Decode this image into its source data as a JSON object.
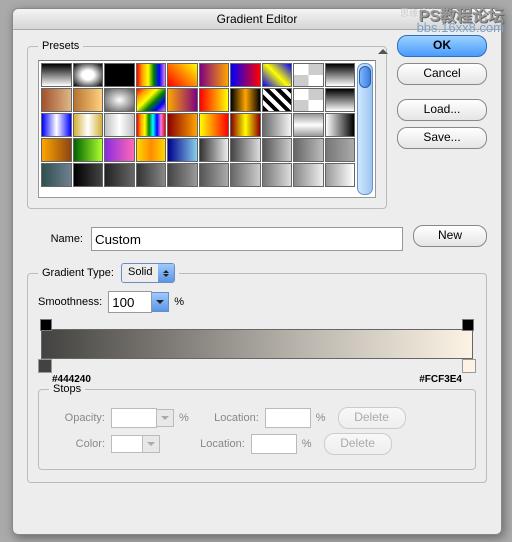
{
  "watermark": {
    "a": "PS教程论坛",
    "b": "思缘设计论坛",
    "c": "bbs.16xx8.com"
  },
  "title": "Gradient Editor",
  "presets": {
    "legend": "Presets",
    "swatches": [
      "linear-gradient(#000,#fff)",
      "radial-gradient(#fff 30%,#000)",
      "linear-gradient(#000,#000)",
      "linear-gradient(90deg,red,orange,yellow,green,blue,violet)",
      "linear-gradient(45deg,red,yellow)",
      "linear-gradient(90deg,purple,orange)",
      "linear-gradient(90deg,blue,red)",
      "linear-gradient(45deg,blue,yellow,blue)",
      "repeating-conic-gradient(#ccc 0 25%,#fff 0 50%)",
      "linear-gradient(#000,#fff)",
      "linear-gradient(90deg,#a0522d,#deb887)",
      "linear-gradient(90deg,#b87333,#ffd27f)",
      "radial-gradient(#fff,#555)",
      "linear-gradient(135deg,red,orange,yellow,green,blue,violet)",
      "linear-gradient(90deg,orange,purple)",
      "linear-gradient(90deg,red,yellow)",
      "linear-gradient(90deg,#000,orange,#000)",
      "repeating-linear-gradient(45deg,#000 0 4px,#fff 4px 8px)",
      "repeating-conic-gradient(#ccc 0 25%,#fff 0 50%)",
      "linear-gradient(#000,#fff)",
      "linear-gradient(90deg,#00f,#fff,#00f)",
      "linear-gradient(90deg,#d4af37,#fff,#d4af37)",
      "linear-gradient(90deg,#c0c0c0,#fff,#c0c0c0)",
      "linear-gradient(90deg,red,orange,yellow,green,cyan,blue,violet,red)",
      "linear-gradient(90deg,#8b0000,#ffa500)",
      "linear-gradient(90deg,#ff0,#f00)",
      "linear-gradient(90deg,#8b0000,#ffff00,#8b0000)",
      "linear-gradient(90deg,#696969,#f5f5f5)",
      "linear-gradient(#999,#fff,#999)",
      "linear-gradient(90deg,#fff,#000)",
      "linear-gradient(90deg,orange,#8b4513)",
      "linear-gradient(90deg,#006400,#adff2f)",
      "linear-gradient(90deg,#8a2be2,#ff69b4)",
      "linear-gradient(90deg,#ffd700,#ff8c00,#ffd700)",
      "linear-gradient(90deg,#00008b,#87ceeb)",
      "linear-gradient(90deg,#333,#eee)",
      "linear-gradient(90deg,#444,#ddd)",
      "linear-gradient(90deg,#555,#ccc)",
      "linear-gradient(90deg,#666,#bbb)",
      "linear-gradient(90deg,#777,#aaa)",
      "linear-gradient(90deg,#2f4f4f,#708090)",
      "linear-gradient(90deg,#000,#444)",
      "linear-gradient(90deg,#222,#666)",
      "linear-gradient(90deg,#333,#888)",
      "linear-gradient(90deg,#444,#999)",
      "linear-gradient(90deg,#555,#aaa)",
      "linear-gradient(90deg,#666,#ccc)",
      "linear-gradient(90deg,#777,#ddd)",
      "linear-gradient(90deg,#888,#eee)",
      "linear-gradient(90deg,#999,#fff)"
    ]
  },
  "buttons": {
    "ok": "OK",
    "cancel": "Cancel",
    "load": "Load...",
    "save": "Save...",
    "new": "New",
    "delete": "Delete"
  },
  "name": {
    "label": "Name:",
    "value": "Custom"
  },
  "gtype": {
    "label": "Gradient Type:",
    "value": "Solid"
  },
  "smooth": {
    "label": "Smoothness:",
    "value": "100",
    "pct": "%"
  },
  "gradient": {
    "left_hex": "#444240",
    "right_hex": "#FCF3E4"
  },
  "stops": {
    "legend": "Stops",
    "opacity": "Opacity:",
    "color": "Color:",
    "location": "Location:",
    "pct": "%"
  }
}
